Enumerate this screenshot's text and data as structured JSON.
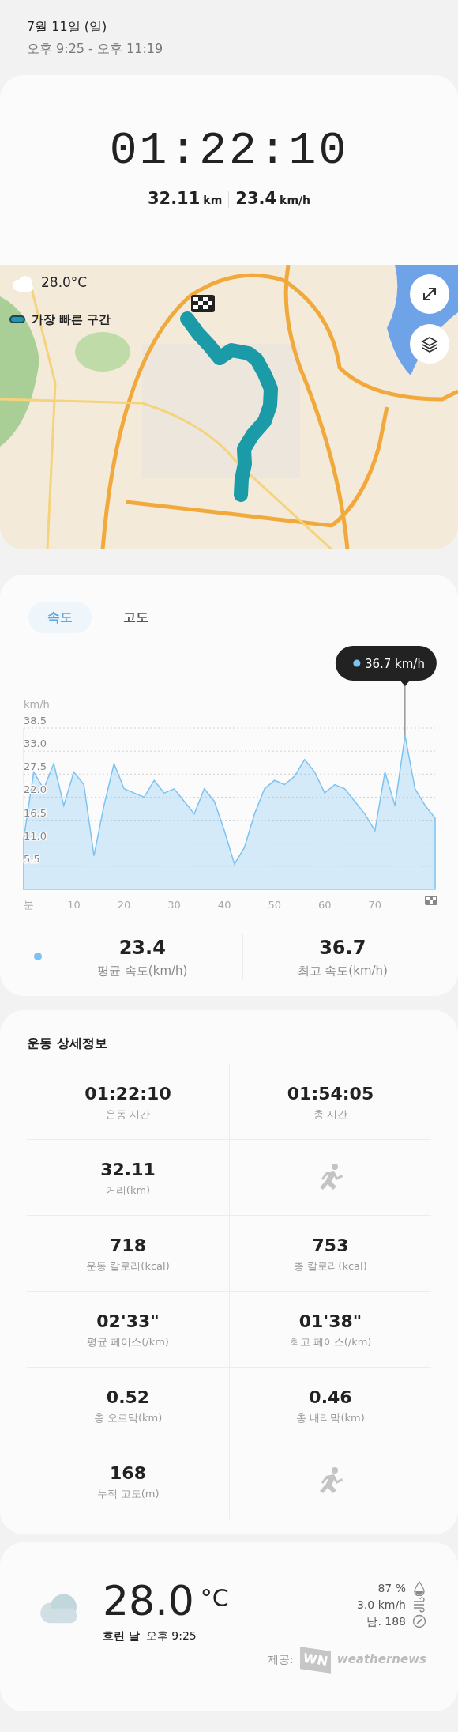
{
  "header": {
    "date": "7월 11일 (일)",
    "time_range": "오후 9:25 - 오후 11:19"
  },
  "summary": {
    "duration": "01:22:10",
    "distance": "32.11",
    "distance_unit": "km",
    "speed": "23.4",
    "speed_unit": "km/h"
  },
  "map": {
    "kind": "picture",
    "temperature": "28.0°C",
    "legend": "가장 빠른 구간"
  },
  "speed_chart": {
    "tabs": [
      {
        "label": "속도",
        "selected": true
      },
      {
        "label": "고도",
        "selected": false
      }
    ],
    "tooltip": "36.7 km/h",
    "chart_data": {
      "type": "area",
      "ylabel": "km/h",
      "x": [
        0,
        2,
        4,
        6,
        8,
        10,
        12,
        14,
        16,
        18,
        20,
        22,
        24,
        26,
        28,
        30,
        32,
        34,
        36,
        38,
        40,
        42,
        44,
        46,
        48,
        50,
        52,
        54,
        56,
        58,
        60,
        62,
        64,
        66,
        68,
        70,
        72,
        74,
        76,
        78,
        80,
        82
      ],
      "series": [
        {
          "color": "#7cc3f2",
          "values": [
            12,
            28,
            24,
            30,
            20,
            28,
            25,
            8,
            20,
            30,
            24,
            23,
            22,
            26,
            23,
            24,
            21,
            18,
            24,
            21,
            14,
            6,
            10,
            18,
            24,
            26,
            25,
            27,
            31,
            28,
            23,
            25,
            24,
            21,
            18,
            14,
            28,
            20,
            36.7,
            24,
            20,
            17
          ]
        }
      ],
      "xlim": [
        0,
        82
      ],
      "ylim": [
        0,
        38.5
      ],
      "grid": true,
      "yticks": [
        {
          "value": 5.5,
          "label": "5.5"
        },
        {
          "value": 11,
          "label": "11.0"
        },
        {
          "value": 16.5,
          "label": "16.5"
        },
        {
          "value": 22,
          "label": "22.0"
        },
        {
          "value": 27.5,
          "label": "27.5"
        },
        {
          "value": 33,
          "label": "33.0"
        },
        {
          "value": 38.5,
          "label": "38.5"
        }
      ],
      "xticks": [
        {
          "value": 0,
          "label": "분"
        },
        10,
        20,
        30,
        40,
        50,
        60,
        70
      ]
    },
    "stats": [
      {
        "value": "23.4",
        "label": "평균 속도(km/h)"
      },
      {
        "value": "36.7",
        "label": "최고 속도(km/h)"
      }
    ]
  },
  "details": {
    "title": "운동 상세정보",
    "cells": [
      {
        "kind": "stat",
        "value": "01:22:10",
        "label": "운동 시간"
      },
      {
        "kind": "stat",
        "value": "01:54:05",
        "label": "총 시간"
      },
      {
        "kind": "stat",
        "value": "32.11",
        "label": "거리(km)"
      },
      {
        "kind": "icon"
      },
      {
        "kind": "stat",
        "value": "718",
        "label": "운동 칼로리(kcal)"
      },
      {
        "kind": "stat",
        "value": "753",
        "label": "총 칼로리(kcal)"
      },
      {
        "kind": "stat",
        "value": "02'33\"",
        "label": "평균 페이스(/km)"
      },
      {
        "kind": "stat",
        "value": "01'38\"",
        "label": "최고 페이스(/km)"
      },
      {
        "kind": "stat",
        "value": "0.52",
        "label": "총 오르막(km)"
      },
      {
        "kind": "stat",
        "value": "0.46",
        "label": "총 내리막(km)"
      },
      {
        "kind": "stat",
        "value": "168",
        "label": "누적 고도(m)"
      },
      {
        "kind": "icon"
      }
    ]
  },
  "weather": {
    "temperature": "28.0",
    "unit": "°C",
    "condition": "흐린 날",
    "time": "오후 9:25",
    "metrics": [
      {
        "kind": "humidity",
        "text": "87 %"
      },
      {
        "kind": "wind",
        "text": "3.0 km/h"
      },
      {
        "kind": "direction",
        "text": "남. 188"
      }
    ],
    "provider_label": "제공:",
    "provider_mark": "WN",
    "provider_name": "weathernews"
  }
}
